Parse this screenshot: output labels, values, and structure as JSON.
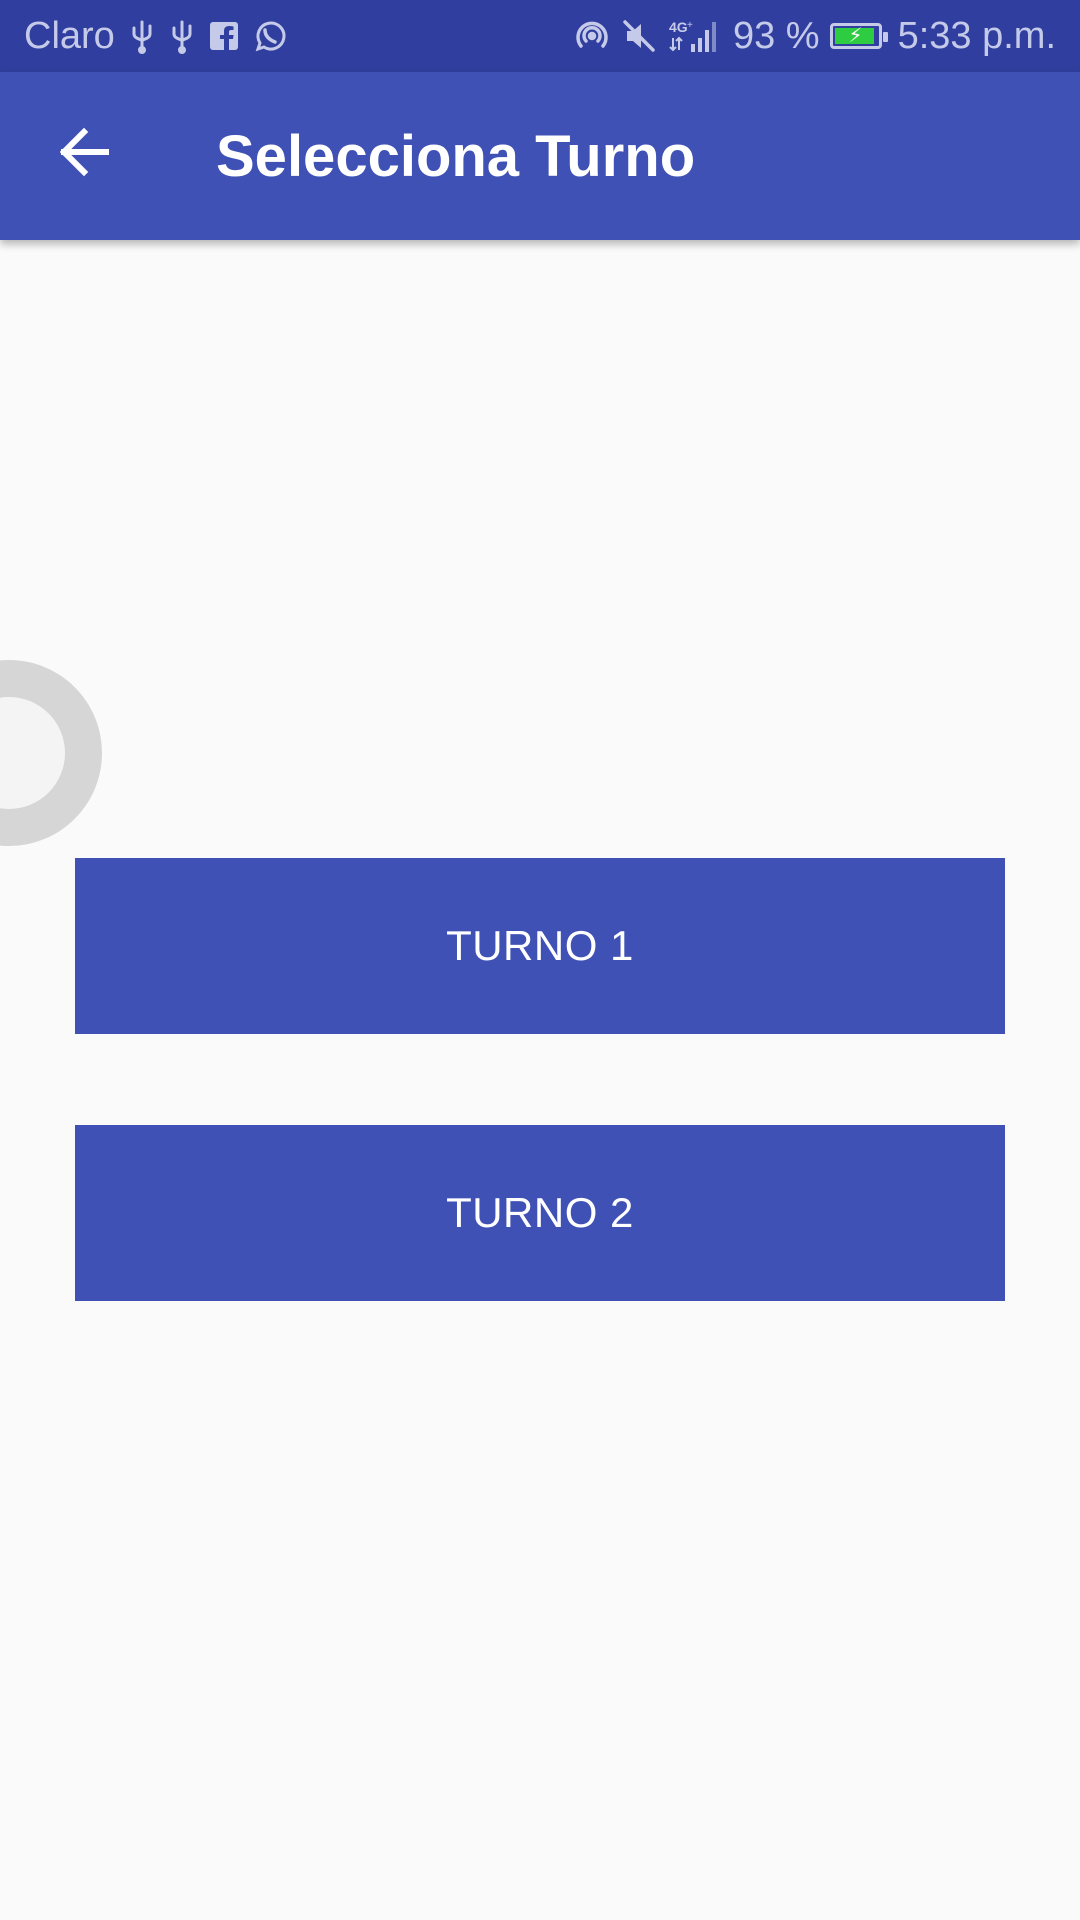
{
  "status_bar": {
    "carrier": "Claro",
    "network": "4G",
    "battery_percent": "93 %",
    "battery_level": 0.93,
    "time": "5:33 p.m.",
    "icons_left": [
      "usb-icon",
      "usb-icon",
      "facebook-icon",
      "whatsapp-icon"
    ],
    "icons_right": [
      "hotspot-icon",
      "mute-icon",
      "signal-icon",
      "battery-icon"
    ]
  },
  "app_bar": {
    "back_icon": "arrow-back-icon",
    "title": "Selecciona Turno"
  },
  "buttons": [
    {
      "label": "TURNO 1"
    },
    {
      "label": "TURNO 2"
    }
  ],
  "colors": {
    "primary": "#3f51b5",
    "primary_dark": "#303f9f",
    "background": "#fafafa",
    "button_text": "#ffffff",
    "battery_fill": "#2ecc40"
  }
}
